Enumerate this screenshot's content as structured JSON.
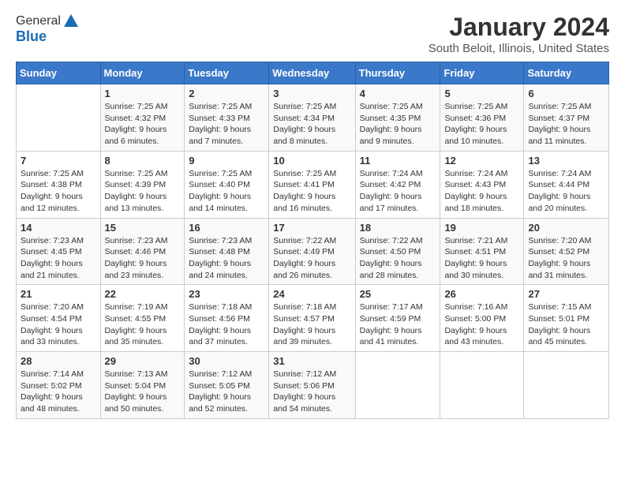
{
  "header": {
    "logo_general": "General",
    "logo_blue": "Blue",
    "title": "January 2024",
    "subtitle": "South Beloit, Illinois, United States"
  },
  "weekdays": [
    "Sunday",
    "Monday",
    "Tuesday",
    "Wednesday",
    "Thursday",
    "Friday",
    "Saturday"
  ],
  "weeks": [
    [
      {
        "day": "",
        "sunrise": "",
        "sunset": "",
        "daylight": ""
      },
      {
        "day": "1",
        "sunrise": "Sunrise: 7:25 AM",
        "sunset": "Sunset: 4:32 PM",
        "daylight": "Daylight: 9 hours and 6 minutes."
      },
      {
        "day": "2",
        "sunrise": "Sunrise: 7:25 AM",
        "sunset": "Sunset: 4:33 PM",
        "daylight": "Daylight: 9 hours and 7 minutes."
      },
      {
        "day": "3",
        "sunrise": "Sunrise: 7:25 AM",
        "sunset": "Sunset: 4:34 PM",
        "daylight": "Daylight: 9 hours and 8 minutes."
      },
      {
        "day": "4",
        "sunrise": "Sunrise: 7:25 AM",
        "sunset": "Sunset: 4:35 PM",
        "daylight": "Daylight: 9 hours and 9 minutes."
      },
      {
        "day": "5",
        "sunrise": "Sunrise: 7:25 AM",
        "sunset": "Sunset: 4:36 PM",
        "daylight": "Daylight: 9 hours and 10 minutes."
      },
      {
        "day": "6",
        "sunrise": "Sunrise: 7:25 AM",
        "sunset": "Sunset: 4:37 PM",
        "daylight": "Daylight: 9 hours and 11 minutes."
      }
    ],
    [
      {
        "day": "7",
        "sunrise": "Sunrise: 7:25 AM",
        "sunset": "Sunset: 4:38 PM",
        "daylight": "Daylight: 9 hours and 12 minutes."
      },
      {
        "day": "8",
        "sunrise": "Sunrise: 7:25 AM",
        "sunset": "Sunset: 4:39 PM",
        "daylight": "Daylight: 9 hours and 13 minutes."
      },
      {
        "day": "9",
        "sunrise": "Sunrise: 7:25 AM",
        "sunset": "Sunset: 4:40 PM",
        "daylight": "Daylight: 9 hours and 14 minutes."
      },
      {
        "day": "10",
        "sunrise": "Sunrise: 7:25 AM",
        "sunset": "Sunset: 4:41 PM",
        "daylight": "Daylight: 9 hours and 16 minutes."
      },
      {
        "day": "11",
        "sunrise": "Sunrise: 7:24 AM",
        "sunset": "Sunset: 4:42 PM",
        "daylight": "Daylight: 9 hours and 17 minutes."
      },
      {
        "day": "12",
        "sunrise": "Sunrise: 7:24 AM",
        "sunset": "Sunset: 4:43 PM",
        "daylight": "Daylight: 9 hours and 18 minutes."
      },
      {
        "day": "13",
        "sunrise": "Sunrise: 7:24 AM",
        "sunset": "Sunset: 4:44 PM",
        "daylight": "Daylight: 9 hours and 20 minutes."
      }
    ],
    [
      {
        "day": "14",
        "sunrise": "Sunrise: 7:23 AM",
        "sunset": "Sunset: 4:45 PM",
        "daylight": "Daylight: 9 hours and 21 minutes."
      },
      {
        "day": "15",
        "sunrise": "Sunrise: 7:23 AM",
        "sunset": "Sunset: 4:46 PM",
        "daylight": "Daylight: 9 hours and 23 minutes."
      },
      {
        "day": "16",
        "sunrise": "Sunrise: 7:23 AM",
        "sunset": "Sunset: 4:48 PM",
        "daylight": "Daylight: 9 hours and 24 minutes."
      },
      {
        "day": "17",
        "sunrise": "Sunrise: 7:22 AM",
        "sunset": "Sunset: 4:49 PM",
        "daylight": "Daylight: 9 hours and 26 minutes."
      },
      {
        "day": "18",
        "sunrise": "Sunrise: 7:22 AM",
        "sunset": "Sunset: 4:50 PM",
        "daylight": "Daylight: 9 hours and 28 minutes."
      },
      {
        "day": "19",
        "sunrise": "Sunrise: 7:21 AM",
        "sunset": "Sunset: 4:51 PM",
        "daylight": "Daylight: 9 hours and 30 minutes."
      },
      {
        "day": "20",
        "sunrise": "Sunrise: 7:20 AM",
        "sunset": "Sunset: 4:52 PM",
        "daylight": "Daylight: 9 hours and 31 minutes."
      }
    ],
    [
      {
        "day": "21",
        "sunrise": "Sunrise: 7:20 AM",
        "sunset": "Sunset: 4:54 PM",
        "daylight": "Daylight: 9 hours and 33 minutes."
      },
      {
        "day": "22",
        "sunrise": "Sunrise: 7:19 AM",
        "sunset": "Sunset: 4:55 PM",
        "daylight": "Daylight: 9 hours and 35 minutes."
      },
      {
        "day": "23",
        "sunrise": "Sunrise: 7:18 AM",
        "sunset": "Sunset: 4:56 PM",
        "daylight": "Daylight: 9 hours and 37 minutes."
      },
      {
        "day": "24",
        "sunrise": "Sunrise: 7:18 AM",
        "sunset": "Sunset: 4:57 PM",
        "daylight": "Daylight: 9 hours and 39 minutes."
      },
      {
        "day": "25",
        "sunrise": "Sunrise: 7:17 AM",
        "sunset": "Sunset: 4:59 PM",
        "daylight": "Daylight: 9 hours and 41 minutes."
      },
      {
        "day": "26",
        "sunrise": "Sunrise: 7:16 AM",
        "sunset": "Sunset: 5:00 PM",
        "daylight": "Daylight: 9 hours and 43 minutes."
      },
      {
        "day": "27",
        "sunrise": "Sunrise: 7:15 AM",
        "sunset": "Sunset: 5:01 PM",
        "daylight": "Daylight: 9 hours and 45 minutes."
      }
    ],
    [
      {
        "day": "28",
        "sunrise": "Sunrise: 7:14 AM",
        "sunset": "Sunset: 5:02 PM",
        "daylight": "Daylight: 9 hours and 48 minutes."
      },
      {
        "day": "29",
        "sunrise": "Sunrise: 7:13 AM",
        "sunset": "Sunset: 5:04 PM",
        "daylight": "Daylight: 9 hours and 50 minutes."
      },
      {
        "day": "30",
        "sunrise": "Sunrise: 7:12 AM",
        "sunset": "Sunset: 5:05 PM",
        "daylight": "Daylight: 9 hours and 52 minutes."
      },
      {
        "day": "31",
        "sunrise": "Sunrise: 7:12 AM",
        "sunset": "Sunset: 5:06 PM",
        "daylight": "Daylight: 9 hours and 54 minutes."
      },
      {
        "day": "",
        "sunrise": "",
        "sunset": "",
        "daylight": ""
      },
      {
        "day": "",
        "sunrise": "",
        "sunset": "",
        "daylight": ""
      },
      {
        "day": "",
        "sunrise": "",
        "sunset": "",
        "daylight": ""
      }
    ]
  ]
}
